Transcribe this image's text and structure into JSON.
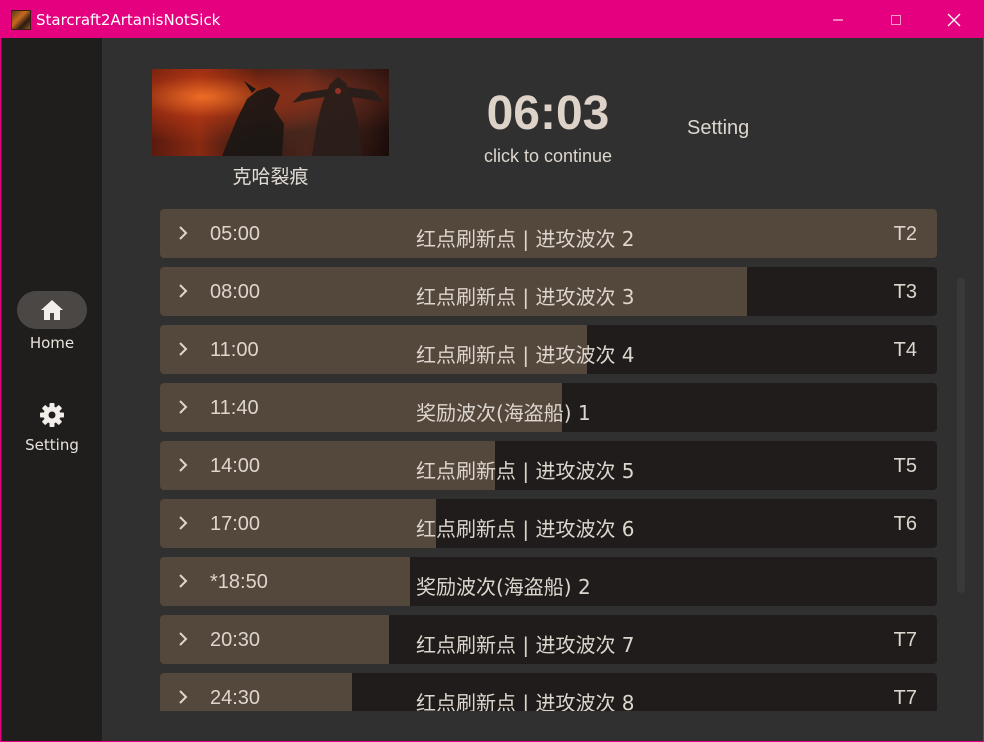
{
  "window": {
    "title": "Starcraft2ArtanisNotSick",
    "app_icon": "app-icon",
    "controls": [
      "minimize-icon",
      "maximize-icon",
      "close-icon"
    ]
  },
  "sidebar": {
    "items": [
      {
        "label": "Home",
        "icon": "home-icon",
        "selected": true
      },
      {
        "label": "Setting",
        "icon": "gear-icon",
        "selected": false
      }
    ]
  },
  "header": {
    "map_name": "克哈裂痕",
    "timer": "06:03",
    "timer_hint": "click to continue",
    "setting_label": "Setting"
  },
  "waves": [
    {
      "time": "05:00",
      "desc": "红点刷新点 | 进攻波次 2",
      "tag": "T2",
      "progress": 1.0
    },
    {
      "time": "08:00",
      "desc": "红点刷新点 | 进攻波次 3",
      "tag": "T3",
      "progress": 0.755
    },
    {
      "time": "11:00",
      "desc": "红点刷新点 | 进攻波次 4",
      "tag": "T4",
      "progress": 0.549
    },
    {
      "time": "11:40",
      "desc": "奖励波次(海盗船) 1",
      "tag": "",
      "progress": 0.518
    },
    {
      "time": "14:00",
      "desc": "红点刷新点 | 进攻波次 5",
      "tag": "T5",
      "progress": 0.431
    },
    {
      "time": "17:00",
      "desc": "红点刷新点 | 进攻波次 6",
      "tag": "T6",
      "progress": 0.355
    },
    {
      "time": "*18:50",
      "desc": "奖励波次(海盗船) 2",
      "tag": "",
      "progress": 0.322
    },
    {
      "time": "20:30",
      "desc": "红点刷新点 | 进攻波次 7",
      "tag": "T7",
      "progress": 0.295
    },
    {
      "time": "24:30",
      "desc": "红点刷新点 | 进攻波次 8",
      "tag": "T7",
      "progress": 0.247
    }
  ],
  "colors": {
    "titlebar": "#e4007f",
    "background": "#313030",
    "sidebar": "#201e1d",
    "row_bg": "#1f1c1b",
    "row_fill": "#54473c",
    "text": "#ddd6ce"
  }
}
